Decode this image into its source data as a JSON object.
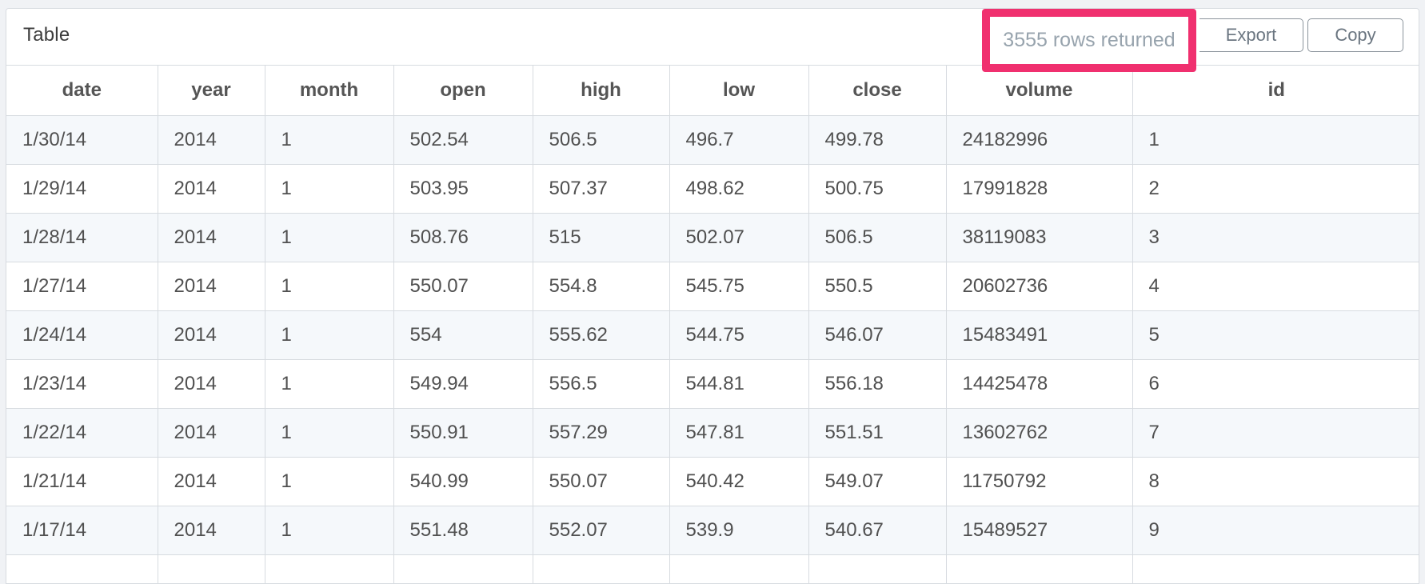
{
  "panel": {
    "title": "Table",
    "rows_returned": "3555 rows returned",
    "export_label": "Export",
    "copy_label": "Copy",
    "highlight_color": "#f0306f"
  },
  "table": {
    "columns": [
      "date",
      "year",
      "month",
      "open",
      "high",
      "low",
      "close",
      "volume",
      "id"
    ],
    "rows": [
      [
        "1/30/14",
        "2014",
        "1",
        "502.54",
        "506.5",
        "496.7",
        "499.78",
        "24182996",
        "1"
      ],
      [
        "1/29/14",
        "2014",
        "1",
        "503.95",
        "507.37",
        "498.62",
        "500.75",
        "17991828",
        "2"
      ],
      [
        "1/28/14",
        "2014",
        "1",
        "508.76",
        "515",
        "502.07",
        "506.5",
        "38119083",
        "3"
      ],
      [
        "1/27/14",
        "2014",
        "1",
        "550.07",
        "554.8",
        "545.75",
        "550.5",
        "20602736",
        "4"
      ],
      [
        "1/24/14",
        "2014",
        "1",
        "554",
        "555.62",
        "544.75",
        "546.07",
        "15483491",
        "5"
      ],
      [
        "1/23/14",
        "2014",
        "1",
        "549.94",
        "556.5",
        "544.81",
        "556.18",
        "14425478",
        "6"
      ],
      [
        "1/22/14",
        "2014",
        "1",
        "550.91",
        "557.29",
        "547.81",
        "551.51",
        "13602762",
        "7"
      ],
      [
        "1/21/14",
        "2014",
        "1",
        "540.99",
        "550.07",
        "540.42",
        "549.07",
        "11750792",
        "8"
      ],
      [
        "1/17/14",
        "2014",
        "1",
        "551.48",
        "552.07",
        "539.9",
        "540.67",
        "15489527",
        "9"
      ],
      [
        "",
        "",
        "",
        "",
        "",
        "",
        "",
        "",
        ""
      ]
    ]
  }
}
